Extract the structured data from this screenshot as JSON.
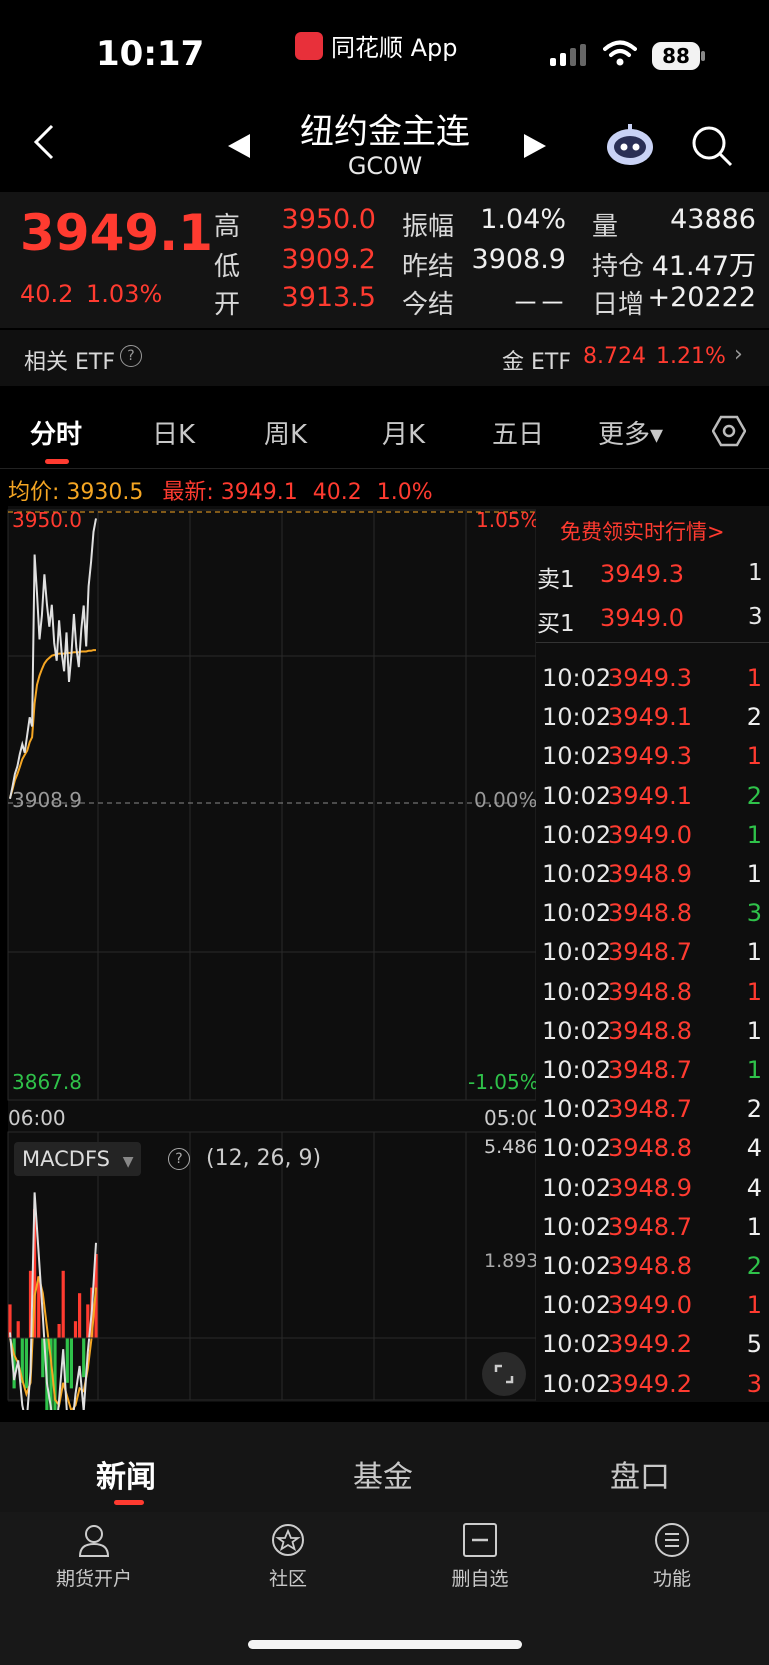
{
  "status": {
    "time": "10:17",
    "app_name": "同花顺 App",
    "battery": "88"
  },
  "header": {
    "title": "纽约金主连",
    "code": "GC0W"
  },
  "quote": {
    "price": "3949.1",
    "change": "40.2",
    "change_pct": "1.03%",
    "rows": [
      [
        {
          "label": "高",
          "value": "3950.0",
          "color": "red"
        },
        {
          "label": "振幅",
          "value": "1.04%",
          "color": "white"
        },
        {
          "label": "量",
          "value": "43886",
          "color": "white"
        }
      ],
      [
        {
          "label": "低",
          "value": "3909.2",
          "color": "red"
        },
        {
          "label": "昨结",
          "value": "3908.9",
          "color": "white"
        },
        {
          "label": "持仓",
          "value": "41.47万",
          "color": "white"
        }
      ],
      [
        {
          "label": "开",
          "value": "3913.5",
          "color": "red"
        },
        {
          "label": "今结",
          "value": "－－",
          "color": "white"
        },
        {
          "label": "日增",
          "value": "+20222",
          "color": "white"
        }
      ]
    ]
  },
  "etf": {
    "label": "相关 ETF",
    "help": "?",
    "name": "金 ETF",
    "value": "8.724",
    "pct": "1.21%",
    "chevron": "›"
  },
  "tabs": [
    {
      "label": "分时",
      "active": true
    },
    {
      "label": "日K"
    },
    {
      "label": "周K"
    },
    {
      "label": "月K"
    },
    {
      "label": "五日"
    },
    {
      "label": "更多▾"
    }
  ],
  "summary": {
    "avg_label": "均价: 3930.5",
    "latest_label": "最新: 3949.1",
    "latest_chg": "40.2",
    "latest_pct": "1.0%"
  },
  "intraday": {
    "y_high": "3950.0",
    "y_mid": "3908.9",
    "y_low": "3867.8",
    "pct_high": "1.05%",
    "pct_mid": "0.00%",
    "pct_low": "-1.05%",
    "x_start": "06:00",
    "x_end": "05:00",
    "price_series": [
      3909.5,
      3911.2,
      3913.0,
      3914.1,
      3915.8,
      3917.2,
      3916.0,
      3918.5,
      3921.0,
      3919.7,
      3944.0,
      3938.5,
      3932.0,
      3935.4,
      3941.2,
      3937.0,
      3933.8,
      3936.9,
      3931.5,
      3929.0,
      3934.7,
      3930.2,
      3927.5,
      3933.0,
      3926.0,
      3929.8,
      3935.6,
      3930.9,
      3928.1,
      3933.4,
      3936.8,
      3931.0,
      3939.5,
      3943.0,
      3947.2,
      3949.1
    ],
    "avg_series": [
      3909.6,
      3910.8,
      3912.1,
      3913.0,
      3914.0,
      3915.1,
      3915.7,
      3916.3,
      3917.5,
      3918.2,
      3923.0,
      3925.6,
      3926.9,
      3927.8,
      3928.6,
      3929.1,
      3929.4,
      3929.7,
      3929.8,
      3929.9,
      3930.0,
      3930.0,
      3930.0,
      3930.1,
      3930.1,
      3930.1,
      3930.2,
      3930.2,
      3930.2,
      3930.3,
      3930.3,
      3930.3,
      3930.4,
      3930.4,
      3930.5,
      3930.5
    ]
  },
  "macd": {
    "name": "MACDFS",
    "params": "(12, 26, 9)",
    "help": "?",
    "y_top": "5.486",
    "y_mid": "1.893",
    "dif": [
      0.2,
      -1.5,
      -0.8,
      -2.4,
      -3.1,
      -1.2,
      5.2,
      3.0,
      0.8,
      -1.6,
      -2.5,
      -3.8,
      -2.2,
      -0.4,
      -2.9,
      -3.4,
      -2.0,
      -1.0,
      -2.6,
      -0.5,
      1.0,
      3.4
    ],
    "dea": [
      0.0,
      -0.6,
      -0.9,
      -1.5,
      -2.0,
      -1.6,
      1.5,
      2.2,
      1.6,
      0.4,
      -0.8,
      -2.2,
      -2.4,
      -1.6,
      -2.1,
      -2.6,
      -2.4,
      -1.8,
      -1.9,
      -1.1,
      0.1,
      1.8
    ],
    "hist": [
      1.2,
      -1.8,
      0.6,
      -1.6,
      -1.8,
      2.4,
      4.6,
      2.2,
      -1.4,
      -3.0,
      -2.8,
      -3.2,
      0.5,
      2.4,
      -1.6,
      -1.8,
      0.6,
      1.6,
      -1.4,
      1.2,
      1.8,
      3.0
    ]
  },
  "book": {
    "free_link": "免费领实时行情>",
    "sell": {
      "label": "卖1",
      "price": "3949.3",
      "vol": "1"
    },
    "buy": {
      "label": "买1",
      "price": "3949.0",
      "vol": "3"
    }
  },
  "trades": [
    {
      "time": "10:02",
      "price": "3949.3",
      "vol": "1",
      "color": "red"
    },
    {
      "time": "10:02",
      "price": "3949.1",
      "vol": "2",
      "color": "white"
    },
    {
      "time": "10:02",
      "price": "3949.3",
      "vol": "1",
      "color": "red"
    },
    {
      "time": "10:02",
      "price": "3949.1",
      "vol": "2",
      "color": "green"
    },
    {
      "time": "10:02",
      "price": "3949.0",
      "vol": "1",
      "color": "green"
    },
    {
      "time": "10:02",
      "price": "3948.9",
      "vol": "1",
      "color": "white"
    },
    {
      "time": "10:02",
      "price": "3948.8",
      "vol": "3",
      "color": "green"
    },
    {
      "time": "10:02",
      "price": "3948.7",
      "vol": "1",
      "color": "white"
    },
    {
      "time": "10:02",
      "price": "3948.8",
      "vol": "1",
      "color": "red"
    },
    {
      "time": "10:02",
      "price": "3948.8",
      "vol": "1",
      "color": "white"
    },
    {
      "time": "10:02",
      "price": "3948.7",
      "vol": "1",
      "color": "green"
    },
    {
      "time": "10:02",
      "price": "3948.7",
      "vol": "2",
      "color": "white"
    },
    {
      "time": "10:02",
      "price": "3948.8",
      "vol": "4",
      "color": "white"
    },
    {
      "time": "10:02",
      "price": "3948.9",
      "vol": "4",
      "color": "white"
    },
    {
      "time": "10:02",
      "price": "3948.7",
      "vol": "1",
      "color": "white"
    },
    {
      "time": "10:02",
      "price": "3948.8",
      "vol": "2",
      "color": "green"
    },
    {
      "time": "10:02",
      "price": "3949.0",
      "vol": "1",
      "color": "red"
    },
    {
      "time": "10:02",
      "price": "3949.2",
      "vol": "5",
      "color": "white"
    },
    {
      "time": "10:02",
      "price": "3949.2",
      "vol": "3",
      "color": "red"
    }
  ],
  "news_tabs": [
    {
      "label": "新闻",
      "active": true
    },
    {
      "label": "基金"
    },
    {
      "label": "盘口"
    }
  ],
  "bottom_nav": [
    {
      "label": "期货开户",
      "icon": "user-icon"
    },
    {
      "label": "社区",
      "icon": "community-icon"
    },
    {
      "label": "删自选",
      "icon": "remove-watchlist-icon"
    },
    {
      "label": "功能",
      "icon": "menu-icon"
    }
  ],
  "colors": {
    "up": "#ff3b30",
    "down": "#2fc24a",
    "avg_line": "#f5a623",
    "price_line": "#e0e0e0",
    "bg": "#000000"
  }
}
